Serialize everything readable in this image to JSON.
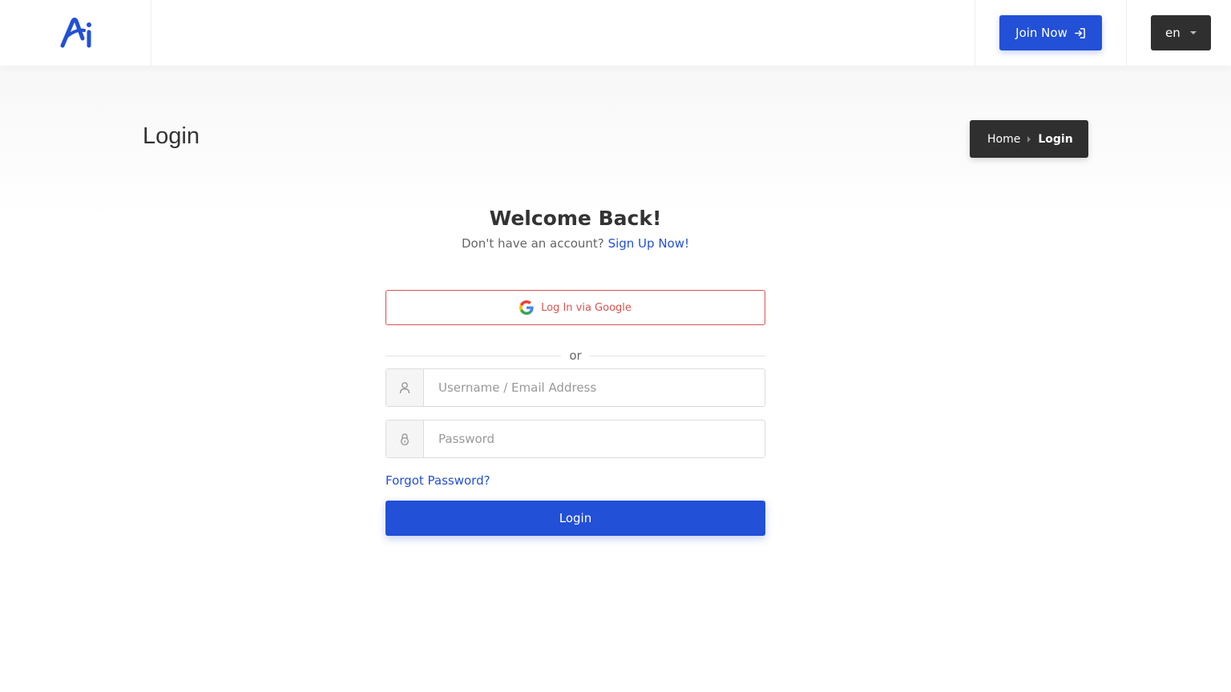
{
  "header": {
    "logo_alt": "Ai",
    "join_label": "Join Now",
    "language": "en"
  },
  "banner": {
    "title": "Login",
    "breadcrumb": {
      "home": "Home",
      "current": "Login"
    }
  },
  "form": {
    "welcome": "Welcome Back!",
    "no_account_text": "Don't have an account?",
    "signup_link": "Sign Up Now!",
    "google_label": "Log In via Google",
    "divider": "or",
    "username_placeholder": "Username / Email Address",
    "password_placeholder": "Password",
    "forgot_label": "Forgot Password?",
    "submit_label": "Login"
  },
  "colors": {
    "primary": "#2250d6",
    "dark": "#2f2f2f",
    "google_red": "#d9534f"
  },
  "icons": {
    "join": "login-arrow-icon",
    "user": "user-icon",
    "lock": "lock-icon",
    "google": "google-icon"
  }
}
